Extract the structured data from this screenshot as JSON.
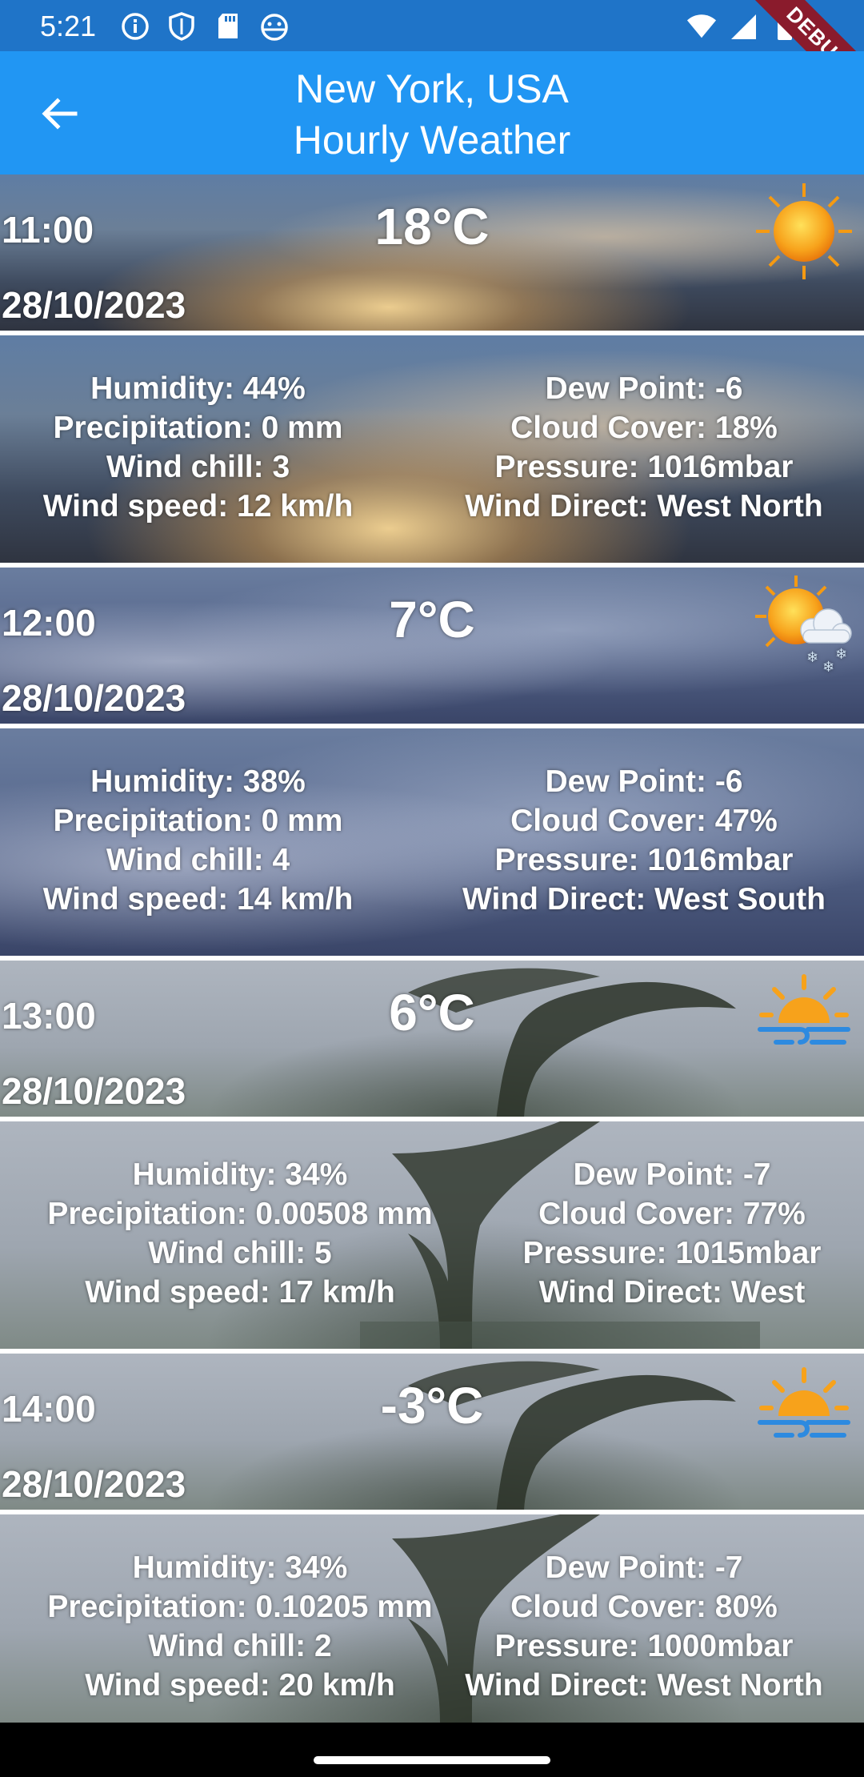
{
  "status_bar": {
    "time": "5:21",
    "left_icons": [
      "info-icon",
      "shield-icon",
      "sd-card-icon",
      "android-icon"
    ],
    "right_icons": [
      "wifi-icon",
      "signal-icon",
      "battery-icon"
    ],
    "debug_label": "DEBUG"
  },
  "app_bar": {
    "title_line1": "New York, USA",
    "title_line2": "Hourly Weather",
    "back_icon": "arrow-back-icon",
    "color": "#2196f3"
  },
  "hours": [
    {
      "time": "11:00",
      "date": "28/10/2023",
      "temp": "18°C",
      "icon": "sun-icon",
      "humidity": "Humidity: 44%",
      "precipitation": "Precipitation: 0 mm",
      "wind_chill": "Wind chill: 3",
      "wind_speed": "Wind speed: 12 km/h",
      "dew_point": "Dew Point: -6",
      "cloud_cover": "Cloud Cover: 18%",
      "pressure": "Pressure: 1016mbar",
      "wind_direct": "Wind Direct: West North"
    },
    {
      "time": "12:00",
      "date": "28/10/2023",
      "temp": "7°C",
      "icon": "sun-cloud-snow-icon",
      "humidity": "Humidity: 38%",
      "precipitation": "Precipitation: 0 mm",
      "wind_chill": "Wind chill: 4",
      "wind_speed": "Wind speed: 14 km/h",
      "dew_point": "Dew Point: -6",
      "cloud_cover": "Cloud Cover: 47%",
      "pressure": "Pressure: 1016mbar",
      "wind_direct": "Wind Direct: West South"
    },
    {
      "time": "13:00",
      "date": "28/10/2023",
      "temp": "6°C",
      "icon": "sun-haze-icon",
      "humidity": "Humidity: 34%",
      "precipitation": "Precipitation: 0.00508 mm",
      "wind_chill": "Wind chill: 5",
      "wind_speed": "Wind speed: 17 km/h",
      "dew_point": "Dew Point: -7",
      "cloud_cover": "Cloud Cover: 77%",
      "pressure": "Pressure: 1015mbar",
      "wind_direct": "Wind Direct: West"
    },
    {
      "time": "14:00",
      "date": "28/10/2023",
      "temp": "-3°C",
      "icon": "sun-haze-icon",
      "humidity": "Humidity: 34%",
      "precipitation": "Precipitation: 0.10205 mm",
      "wind_chill": "Wind chill: 2",
      "wind_speed": "Wind speed: 20 km/h",
      "dew_point": "Dew Point: -7",
      "cloud_cover": "Cloud Cover: 80%",
      "pressure": "Pressure: 1000mbar",
      "wind_direct": "Wind Direct: West North"
    }
  ]
}
